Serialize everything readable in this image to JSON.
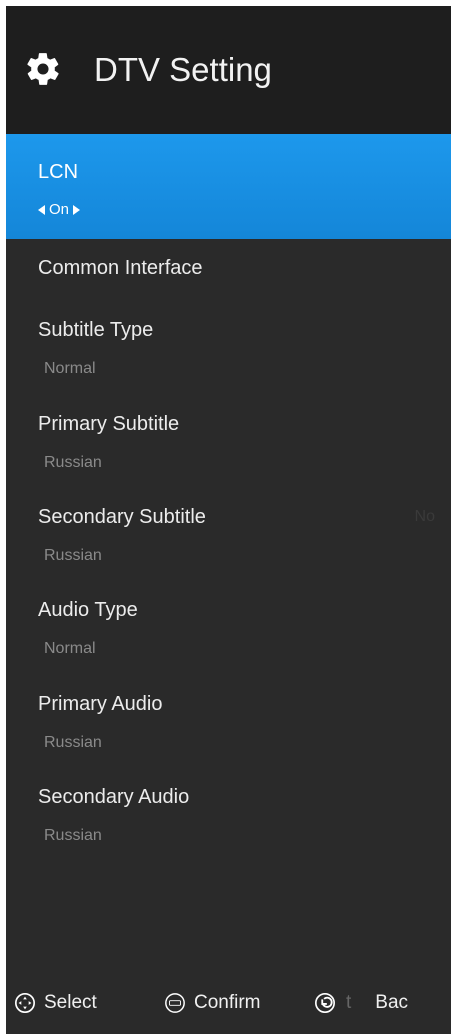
{
  "header": {
    "title": "DTV Setting",
    "icon": "gear-icon"
  },
  "colors": {
    "background": "#2a2a2a",
    "header": "#1e1e1e",
    "accent": "#1a8fe3",
    "text": "#ececec",
    "subtext": "#8a8a8a"
  },
  "menu": {
    "items": [
      {
        "label": "LCN",
        "value": "On",
        "selected": true
      },
      {
        "label": "Common Interface",
        "value": ""
      },
      {
        "label": "Subtitle Type",
        "value": "Normal"
      },
      {
        "label": "Primary Subtitle",
        "value": "Russian"
      },
      {
        "label": "Secondary Subtitle",
        "value": "Russian",
        "ghost": "No"
      },
      {
        "label": "Audio Type",
        "value": "Normal"
      },
      {
        "label": "Primary Audio",
        "value": "Russian"
      },
      {
        "label": "Secondary Audio",
        "value": "Russian"
      }
    ]
  },
  "footer": {
    "select_label": "Select",
    "select_icon": "dpad-icon",
    "confirm_label": "Confirm",
    "confirm_icon": "enter-icon",
    "back_fragment": "t",
    "back_label": "Bac",
    "back_icon": "return-icon"
  }
}
